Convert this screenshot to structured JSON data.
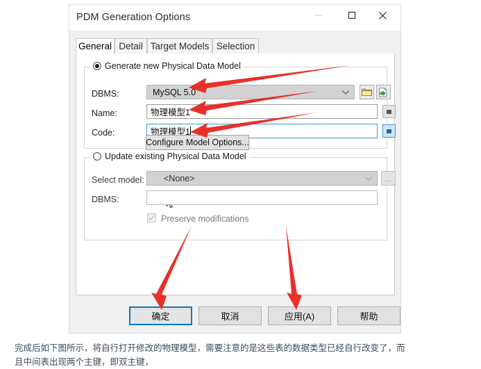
{
  "window": {
    "title": "PDM Generation Options",
    "controls": {
      "minimize": "minimize-button",
      "maximize": "maximize-button",
      "close": "close-button"
    }
  },
  "tabs": [
    {
      "label": "General",
      "active": true
    },
    {
      "label": "Detail",
      "active": false
    },
    {
      "label": "Target Models",
      "active": false
    },
    {
      "label": "Selection",
      "active": false
    }
  ],
  "generate_group": {
    "legend": "Generate new Physical Data Model",
    "radio_selected": true,
    "dbms": {
      "label": "DBMS:",
      "value": "MySQL 5.0",
      "browse_icon": "folder-icon",
      "import_icon": "green-arrow-page-icon"
    },
    "name": {
      "label": "Name:",
      "value": "物理模型1",
      "placeholder": ""
    },
    "code": {
      "label": "Code:",
      "value": "物理模型1",
      "placeholder": "",
      "focused": true
    },
    "configure_button": "Configure Model Options..."
  },
  "update_group": {
    "legend": "Update existing Physical Data Model",
    "radio_selected": false,
    "select_model": {
      "label": "Select model:",
      "value": "<None>",
      "ellipsis_button": "..."
    },
    "dbms": {
      "label": "DBMS:",
      "value": ""
    },
    "preserve": {
      "label": "Preserve modifications",
      "checked": true
    }
  },
  "dialog_buttons": [
    {
      "label": "确定",
      "default": true
    },
    {
      "label": "取消",
      "default": false
    },
    {
      "label": "应用(A)",
      "default": false
    },
    {
      "label": "帮助",
      "default": false
    }
  ],
  "caption": {
    "line1": "完成后如下图所示，将自行打开修改的物理模型，需要注意的是这些表的数据类型已经自行改变了，而",
    "line2": "且中间表出现两个主键，即双主键，"
  },
  "annotations": {
    "arrow_color": "#e8302a",
    "count": 5
  }
}
